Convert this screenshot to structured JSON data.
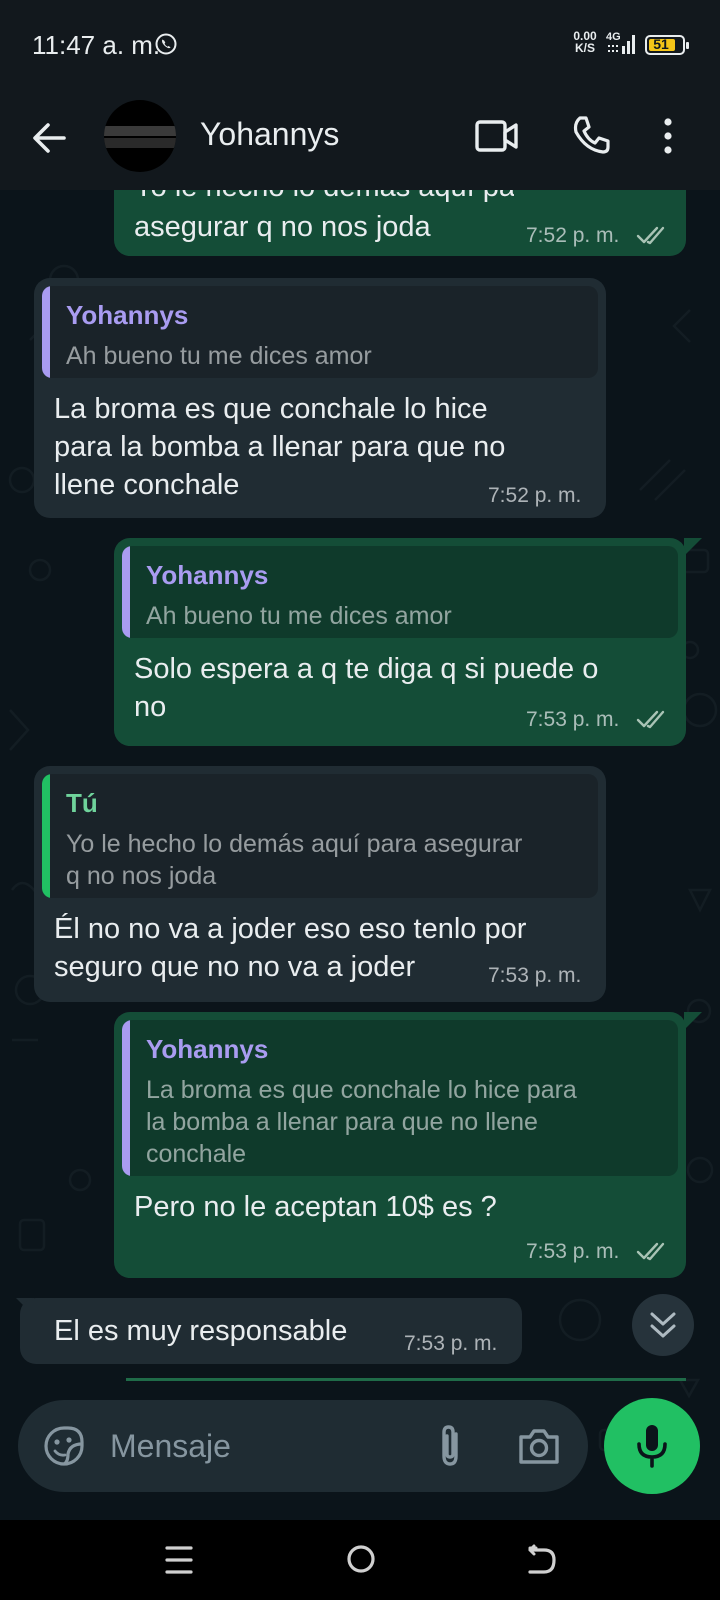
{
  "status_bar": {
    "time": "11:47 a. m.",
    "net_speed_value": "0.00",
    "net_speed_unit": "K/S",
    "network": "4G",
    "battery": "51"
  },
  "header": {
    "contact_name": "Yohannys"
  },
  "messages": [
    {
      "direction": "out",
      "text": "Yo le hecho lo demás aquí para asegurar q no nos joda",
      "visible_text": "asegurar q no nos joda",
      "time": "7:52 p. m.",
      "status": "read"
    },
    {
      "direction": "in",
      "quote_author": "Yohannys",
      "quote_text": "Ah bueno tu me dices amor",
      "text_lines": [
        "La broma es que conchale lo hice",
        "para la bomba a llenar para que no",
        "llene conchale"
      ],
      "time": "7:52 p. m."
    },
    {
      "direction": "out",
      "quote_author": "Yohannys",
      "quote_text": "Ah bueno tu me dices amor",
      "text_lines": [
        "Solo espera a q te diga q si puede o",
        "no"
      ],
      "time": "7:53 p. m.",
      "status": "read"
    },
    {
      "direction": "in",
      "quote_author": "Tú",
      "quote_text_lines": [
        "Yo le hecho lo demás aquí para asegurar",
        "q no nos joda"
      ],
      "text_lines": [
        "Él no no va a joder eso eso tenlo por",
        "seguro que no no va a joder"
      ],
      "time": "7:53 p. m."
    },
    {
      "direction": "out",
      "quote_author": "Yohannys",
      "quote_text_lines": [
        "La broma es que conchale lo hice para",
        "la bomba a llenar para que no llene",
        "conchale"
      ],
      "text_lines": [
        "Pero no le aceptan 10$ es ?"
      ],
      "time": "7:53 p. m.",
      "status": "read"
    },
    {
      "direction": "in",
      "text_lines": [
        "El es muy responsable"
      ],
      "time": "7:53 p. m."
    }
  ],
  "compose": {
    "placeholder": "Mensaje"
  },
  "colors": {
    "outgoing_bubble": "#144d37",
    "incoming_bubble": "#202c33",
    "quote_author_contact": "#a99cf1",
    "quote_author_self": "#6fd39b",
    "read_ticks": "#a9c3b5",
    "mic_button": "#21c063"
  },
  "icons": {
    "back": "arrow-left-icon",
    "video": "video-call-icon",
    "call": "phone-icon",
    "more": "more-vertical-icon",
    "sticker": "sticker-icon",
    "attach": "paperclip-icon",
    "camera": "camera-icon",
    "mic": "microphone-icon",
    "scroll_down": "double-chevron-down-icon"
  }
}
